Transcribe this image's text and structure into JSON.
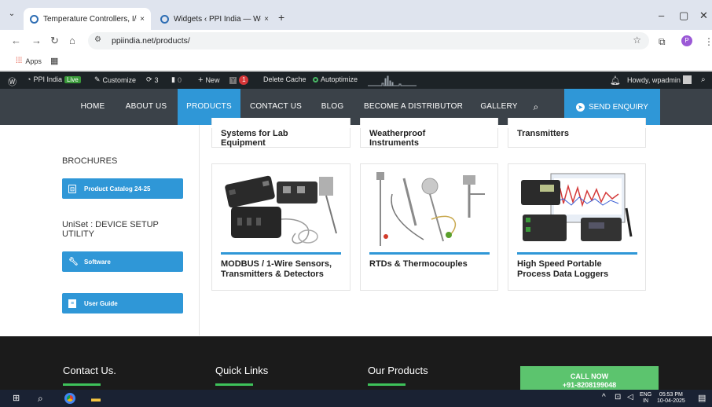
{
  "browser": {
    "tabs": [
      {
        "title": "Temperature Controllers, I/O M",
        "close": "×"
      },
      {
        "title": "Widgets ‹ PPI India — WordPre",
        "close": "×"
      }
    ],
    "new_tab": "+",
    "window_controls": [
      "–",
      "▢",
      "✕"
    ],
    "url": "ppiindia.net/products/",
    "bookmarks": {
      "apps_label": "Apps"
    },
    "profile_initial": "P"
  },
  "wp_admin_bar": {
    "site_name": "PPI India",
    "live_badge": "Live",
    "customize": "Customize",
    "revisions_count": "3",
    "comments_count": "0",
    "new": "New",
    "notification_count": "1",
    "delete_cache": "Delete Cache",
    "autoptimize": "Autoptimize",
    "greeting": "Howdy, wpadmin"
  },
  "site_nav": {
    "items": [
      "HOME",
      "ABOUT US",
      "PRODUCTS",
      "CONTACT US",
      "BLOG",
      "BECOME A DISTRIBUTOR",
      "GALLERY"
    ],
    "active": "PRODUCTS",
    "enquiry": "SEND ENQUIRY"
  },
  "sidebar": {
    "brochures_heading": "BROCHURES",
    "catalog_button": "Product Catalog 24-25",
    "uniset_heading_line1": "UniSet : DEVICE SETUP",
    "uniset_heading_line2": "UTILITY",
    "software_button": "Software",
    "guide_button": "User Guide"
  },
  "products_top_row": [
    {
      "line1": "Systems for Lab",
      "line2": "Equipment"
    },
    {
      "line1": "Weatherproof",
      "line2": "Instruments"
    },
    {
      "line1": "Transmitters",
      "line2": ""
    }
  ],
  "products": [
    {
      "title_line1": "MODBUS / 1-Wire Sensors,",
      "title_line2": "Transmitters & Detectors"
    },
    {
      "title_line1": "RTDs & Thermocouples",
      "title_line2": ""
    },
    {
      "title_line1": "High Speed Portable",
      "title_line2": "Process Data Loggers"
    }
  ],
  "footer": {
    "contact_heading": "Contact Us.",
    "links_heading": "Quick Links",
    "products_heading": "Our Products",
    "call_label": "CALL NOW",
    "call_number": "+91-8208199048"
  },
  "taskbar": {
    "lang": "ENG",
    "region": "IN",
    "time": "05:53 PM",
    "date": "10-04-2025"
  },
  "colors": {
    "accent_blue": "#2f97d7",
    "nav_bg": "#3b4249",
    "footer_bg": "#1b1b1b",
    "call_green": "#5cc46e"
  }
}
